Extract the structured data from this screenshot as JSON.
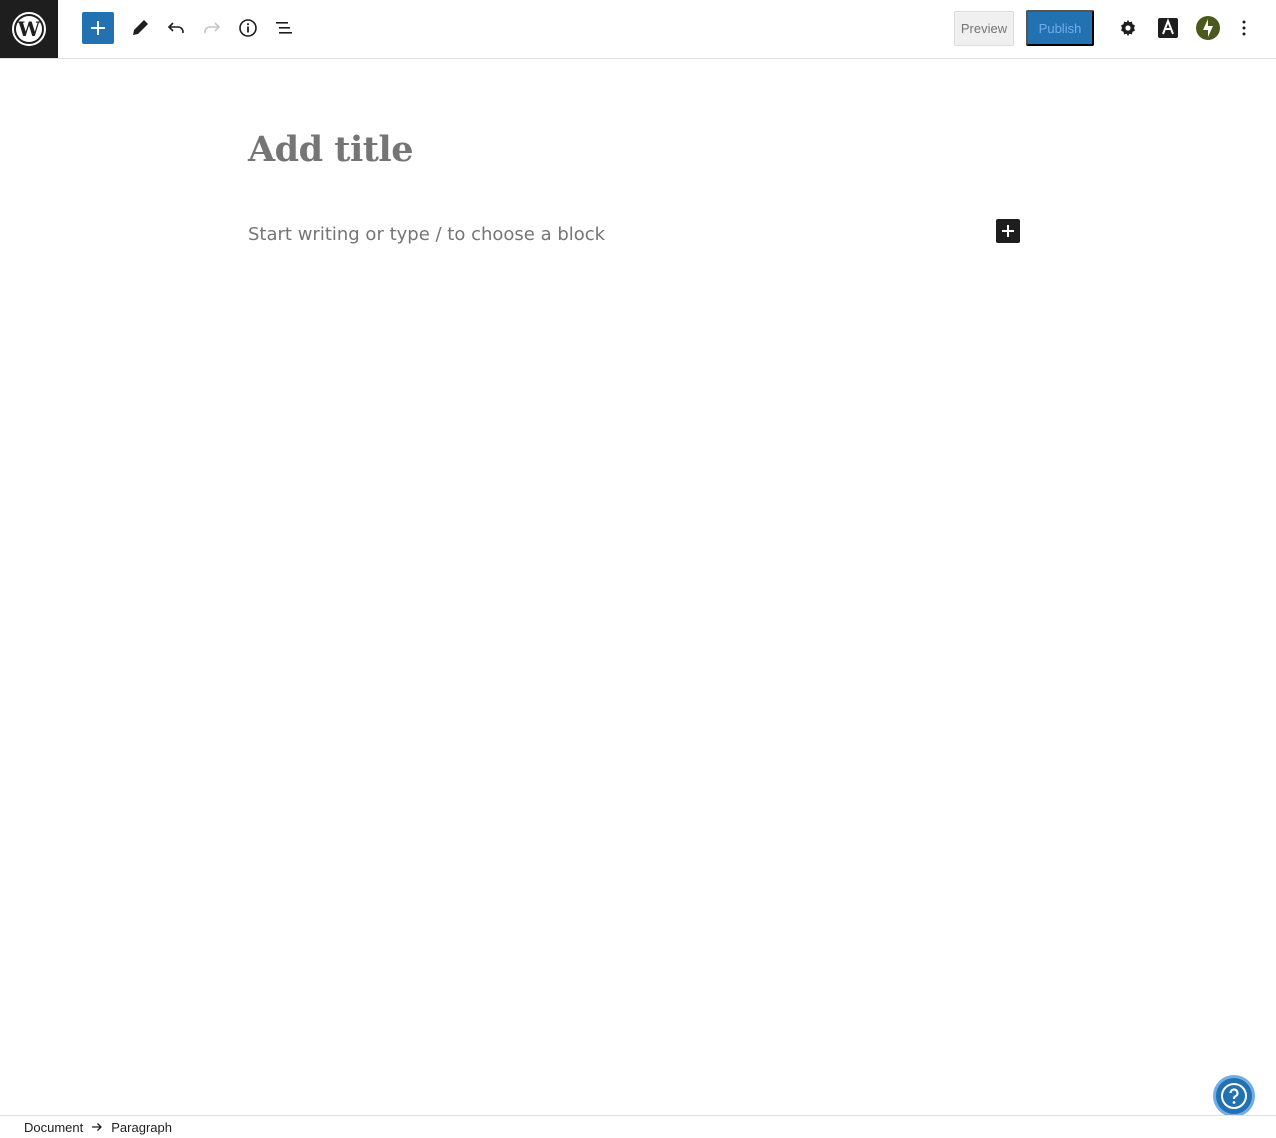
{
  "topbar": {
    "logo_icon": "wordpress-logo-icon",
    "inserter_icon": "plus-icon",
    "tools_icon": "pencil-icon",
    "undo_icon": "undo-icon",
    "redo_icon": "redo-icon",
    "details_icon": "info-icon",
    "outline_icon": "list-view-icon",
    "preview_label": "Preview",
    "publish_label": "Publish",
    "settings_icon": "gear-icon",
    "styles_icon": "typography-icon",
    "jetpack_icon": "jetpack-icon",
    "options_icon": "more-vertical-icon",
    "accent_color": "#2271b1"
  },
  "editor": {
    "title_placeholder": "Add title",
    "block_placeholder": "Start writing or type / to choose a block",
    "block_inserter_icon": "plus-icon"
  },
  "help": {
    "icon": "help-icon"
  },
  "footer": {
    "breadcrumbs": [
      "Document",
      "Paragraph"
    ],
    "separator_icon": "arrow-right-icon"
  }
}
